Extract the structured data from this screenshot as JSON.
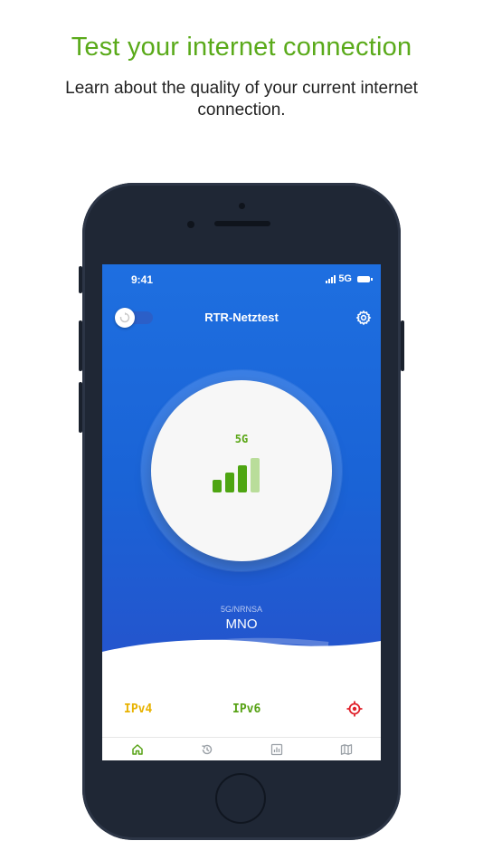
{
  "headline": "Test your internet connection",
  "subline": "Learn about the quality of your current internet connection.",
  "status_bar": {
    "time": "9:41",
    "network": "5G"
  },
  "app": {
    "title": "RTR-Netztest"
  },
  "dial": {
    "technology": "5G",
    "signal_level": 3,
    "signal_max": 4
  },
  "connection": {
    "network_type": "5G/NRNSA",
    "operator": "MNO"
  },
  "indicators": {
    "ipv4": "IPv4",
    "ipv6": "IPv6"
  },
  "tabs": [
    {
      "icon": "home-icon",
      "active": true
    },
    {
      "icon": "history-icon",
      "active": false
    },
    {
      "icon": "statistics-icon",
      "active": false
    },
    {
      "icon": "map-icon",
      "active": false
    }
  ],
  "colors": {
    "accent_green": "#5aaa1a",
    "ipv4_yellow": "#e8b200",
    "location_red": "#e0202a",
    "screen_blue": "#1e6fe0"
  }
}
